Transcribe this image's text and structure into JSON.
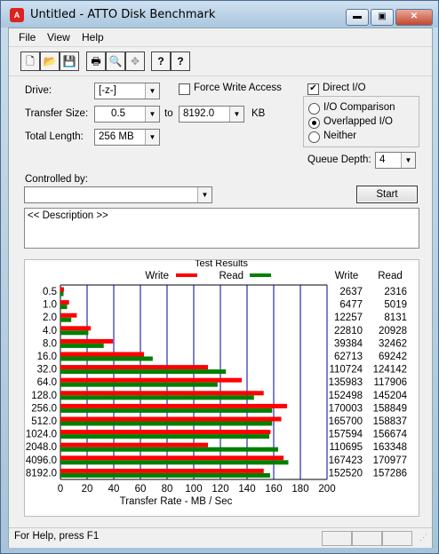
{
  "window": {
    "title": "Untitled - ATTO Disk Benchmark",
    "minimize": "▬",
    "maximize": "▣",
    "close": "✕"
  },
  "menu": [
    "File",
    "View",
    "Help"
  ],
  "toolbar": [
    {
      "icon": "new-file-icon",
      "glyph": "🗋"
    },
    {
      "icon": "open-folder-icon",
      "glyph": "📂"
    },
    {
      "icon": "save-icon",
      "glyph": "💾"
    },
    {
      "icon": "print-icon",
      "glyph": "🖶"
    },
    {
      "icon": "print-preview-icon",
      "glyph": "🔍"
    },
    {
      "icon": "move-icon",
      "glyph": "✥"
    },
    {
      "icon": "help-icon",
      "glyph": "?"
    },
    {
      "icon": "context-help-icon",
      "glyph": "?"
    }
  ],
  "settings": {
    "drive_label": "Drive:",
    "drive_value": "[-z-]",
    "force_write_access_label": "Force Write Access",
    "force_write_access_checked": false,
    "direct_io_label": "Direct I/O",
    "direct_io_checked": true,
    "transfer_size_label": "Transfer Size:",
    "transfer_from": "0.5",
    "to_label": "to",
    "transfer_to": "8192.0",
    "kb_label": "KB",
    "total_length_label": "Total Length:",
    "total_length_value": "256 MB",
    "io_comparison_label": "I/O Comparison",
    "overlapped_io_label": "Overlapped I/O",
    "neither_label": "Neither",
    "selected_mode": "Overlapped I/O",
    "queue_depth_label": "Queue Depth:",
    "queue_depth_value": "4",
    "controlled_by_label": "Controlled by:",
    "controlled_by_value": "",
    "start_label": "Start",
    "description_text": "<< Description >>"
  },
  "results": {
    "group_label": "Test Results",
    "legend_write": "Write",
    "legend_read": "Read",
    "col_write": "Write",
    "col_read": "Read",
    "xlabel": "Transfer Rate - MB / Sec"
  },
  "colors": {
    "write": "#ff0000",
    "read": "#008000",
    "grid": "#0000a0"
  },
  "chart_data": {
    "type": "bar",
    "orientation": "horizontal",
    "categories": [
      "0.5",
      "1.0",
      "2.0",
      "4.0",
      "8.0",
      "16.0",
      "32.0",
      "64.0",
      "128.0",
      "256.0",
      "512.0",
      "1024.0",
      "2048.0",
      "4096.0",
      "8192.0"
    ],
    "series": [
      {
        "name": "Write",
        "values": [
          2637,
          6477,
          12257,
          22810,
          39384,
          62713,
          110724,
          135983,
          152498,
          170003,
          165700,
          157594,
          110695,
          167423,
          152520
        ]
      },
      {
        "name": "Read",
        "values": [
          2316,
          5019,
          8131,
          20928,
          32462,
          69242,
          124142,
          117906,
          145204,
          158849,
          158837,
          156674,
          163348,
          170977,
          157286
        ]
      }
    ],
    "xlabel": "Transfer Rate - MB / Sec",
    "xlim": [
      0,
      200
    ],
    "xticks": [
      0,
      20,
      40,
      60,
      80,
      100,
      120,
      140,
      160,
      180,
      200
    ],
    "value_unit_divisor": 1000
  },
  "status": {
    "text": "For Help, press F1"
  }
}
